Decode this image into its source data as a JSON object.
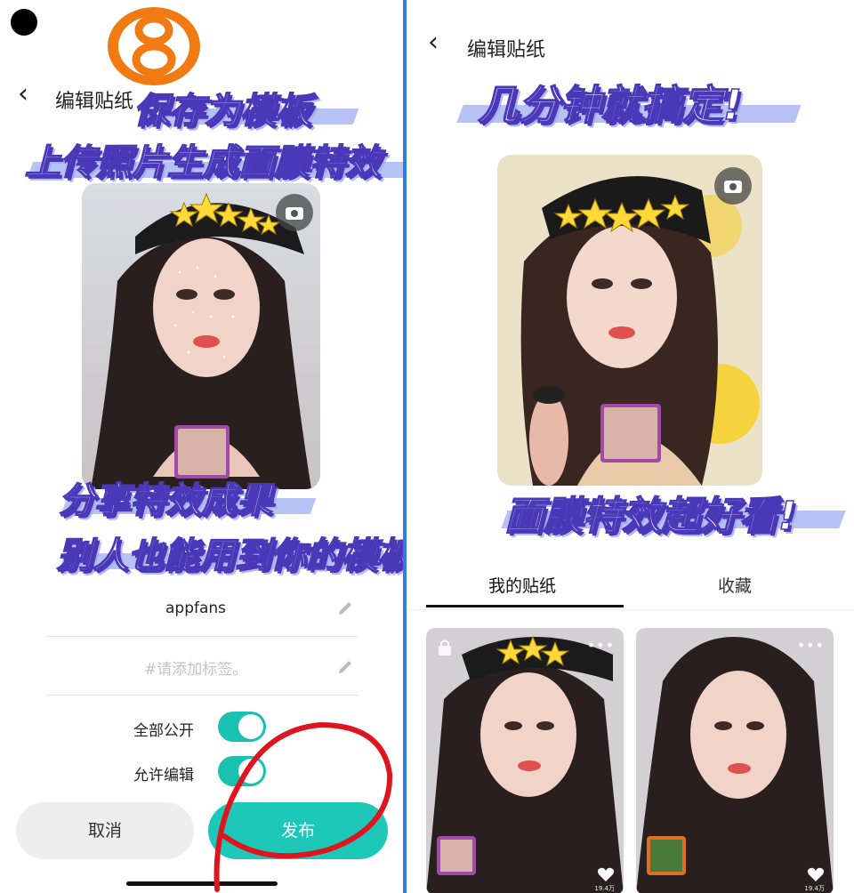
{
  "left": {
    "header": {
      "back_icon": "chevron-left-icon",
      "title": "编辑贴纸"
    },
    "overlay": {
      "line1": "保存为模板",
      "line2": "上传照片生成面膜特效",
      "line3": "分享特效成果",
      "line4": "别人也能用到你的模板"
    },
    "form": {
      "name_value": "appfans",
      "tag_placeholder": "#请添加标签。",
      "toggle_public_label": "全部公开",
      "toggle_public_on": true,
      "toggle_edit_label": "允许编辑",
      "toggle_edit_on": true
    },
    "buttons": {
      "cancel": "取消",
      "publish": "发布"
    }
  },
  "right": {
    "header": {
      "back_icon": "chevron-left-icon",
      "title": "编辑贴纸"
    },
    "overlay": {
      "line1": "几分钟就搞定!",
      "line2": "面膜特效超好看!"
    },
    "tabs": [
      {
        "label": "我的贴纸",
        "active": true
      },
      {
        "label": "收藏",
        "active": false
      }
    ],
    "cards": [
      {
        "likes": "19.4万",
        "thumb_border": "#a24aa8"
      },
      {
        "likes": "19.4万",
        "thumb_border": "#e07020"
      }
    ]
  },
  "colors": {
    "accent": "#1ec8b8",
    "divider": "#2f7fe0",
    "overlay_outline": "#4a38b8",
    "annotation": "#e0141e"
  }
}
